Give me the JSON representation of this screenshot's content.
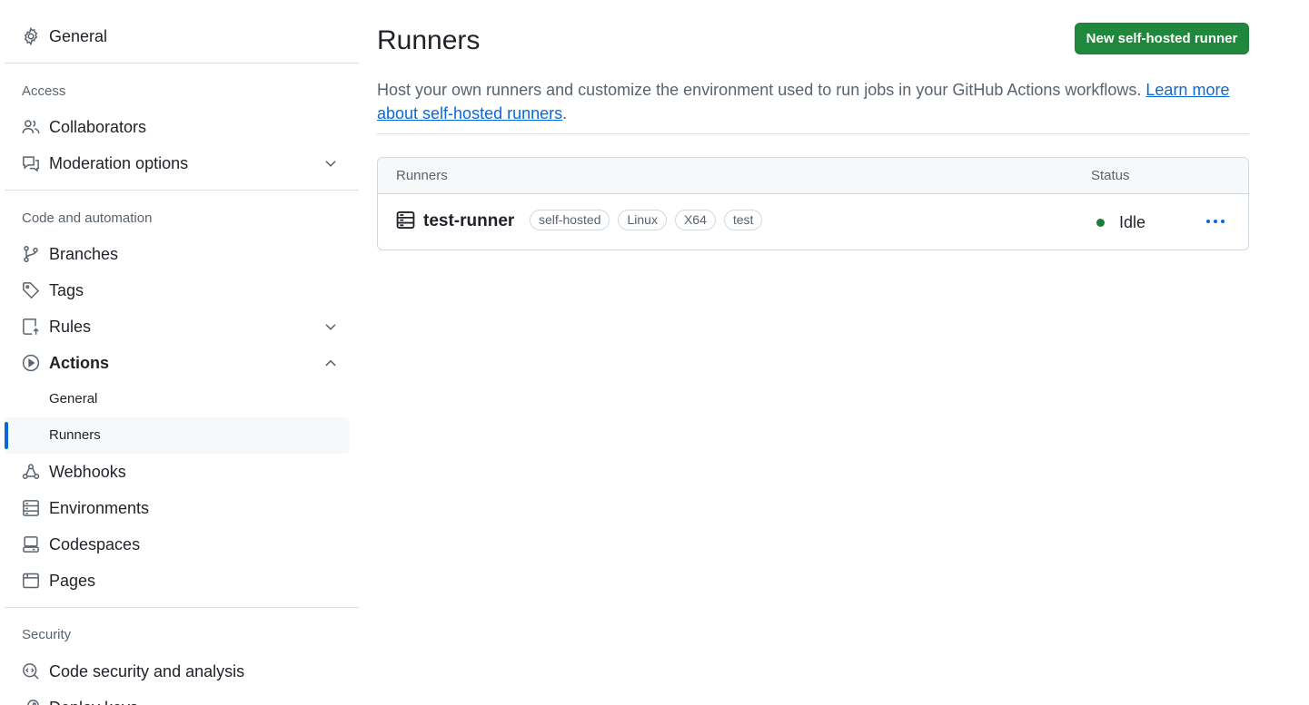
{
  "sidebar": {
    "general": "General",
    "access_title": "Access",
    "collaborators": "Collaborators",
    "moderation": "Moderation options",
    "code_automation_title": "Code and automation",
    "branches": "Branches",
    "tags": "Tags",
    "rules": "Rules",
    "actions": "Actions",
    "actions_sub": {
      "general": "General",
      "runners": "Runners"
    },
    "webhooks": "Webhooks",
    "environments": "Environments",
    "codespaces": "Codespaces",
    "pages": "Pages",
    "security_title": "Security",
    "code_security": "Code security and analysis",
    "deploy_keys": "Deploy keys",
    "icons": [
      "gear-icon",
      "people-icon",
      "report-icon",
      "chevron-down-icon",
      "git-branch-icon",
      "tag-icon",
      "repo-push-icon",
      "play-icon",
      "chevron-up-icon",
      "webhook-icon",
      "server-icon",
      "codespaces-icon",
      "browser-icon",
      "codescan-icon",
      "key-icon"
    ]
  },
  "main": {
    "title": "Runners",
    "new_runner_button": "New self-hosted runner",
    "description_text": "Host your own runners and customize the environment used to run jobs in your GitHub Actions workflows. ",
    "learn_more_link": "Learn more about self-hosted runners",
    "description_end": ".",
    "table": {
      "col_runners": "Runners",
      "col_status": "Status",
      "rows": [
        {
          "name": "test-runner",
          "labels": [
            "self-hosted",
            "Linux",
            "X64",
            "test"
          ],
          "status": "Idle"
        }
      ]
    }
  },
  "colors": {
    "accent": "#0969da",
    "primary_button": "#1f883d",
    "status_idle": "#1a7f37",
    "muted_text": "#59636e",
    "border": "#d1d9e0"
  }
}
